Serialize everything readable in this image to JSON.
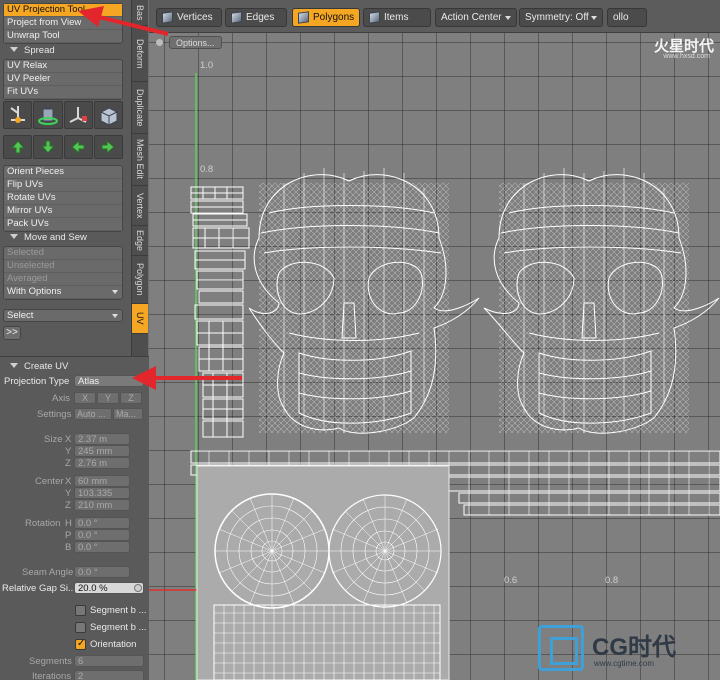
{
  "toolpanel": {
    "projection_items": [
      {
        "label": "UV Projection Tool",
        "selected": true
      },
      {
        "label": "Project from View",
        "selected": false
      },
      {
        "label": "Unwrap Tool",
        "selected": false
      }
    ],
    "spread_header": "Spread",
    "spread_items": [
      "UV Relax",
      "UV Peeler",
      "Fit UVs"
    ],
    "icon_buttons": [
      "uv-transform-icon",
      "uv-rotate-icon",
      "uv-scale-icon",
      "uv-box-icon"
    ],
    "arrow_buttons": [
      "arrow-up-icon",
      "arrow-down-icon",
      "arrow-left-icon",
      "arrow-right-icon"
    ],
    "orient_items": [
      "Orient Pieces",
      "Flip UVs",
      "Rotate UVs",
      "Mirror UVs",
      "Pack UVs"
    ],
    "move_sew_header": "Move and Sew",
    "move_sew_items": [
      {
        "label": "Selected",
        "dim": true
      },
      {
        "label": "Unselected",
        "dim": true
      },
      {
        "label": "Averaged",
        "dim": true
      },
      {
        "label": "With Options",
        "dim": false
      }
    ],
    "select_label": "Select",
    "more_label": ">>"
  },
  "vtabs": [
    "Bas",
    "Deform",
    "Duplicate",
    "Mesh Edit",
    "Vertex",
    "Edge",
    "Polygon",
    "UV"
  ],
  "props": {
    "header": "Create UV",
    "projection_type_label": "Projection Type",
    "projection_type_value": "Atlas",
    "axis_label": "Axis",
    "axis_options": [
      "X",
      "Y",
      "Z"
    ],
    "settings_label": "Settings",
    "settings_options": [
      "Auto ...",
      "Ma..."
    ],
    "size_label": "Size",
    "size": {
      "x": "2.37 m",
      "y": "245 mm",
      "z": "2.76 m"
    },
    "center_label": "Center",
    "center": {
      "x": "60 mm",
      "y": "103.335",
      "z": "210 mm"
    },
    "rotation_label": "Rotation",
    "rotation": {
      "h": "0.0 °",
      "p": "0.0 °",
      "b": "0.0 °"
    },
    "seam_angle_label": "Seam Angle",
    "seam_angle_value": "0.0 °",
    "relative_gap_label": "Relative Gap Si...",
    "relative_gap_value": "20.0 %",
    "checkboxes": [
      {
        "label": "Segment b ...",
        "checked": false
      },
      {
        "label": "Segment b ...",
        "checked": false
      },
      {
        "label": "Orientation",
        "checked": true
      }
    ],
    "segments_label": "Segments",
    "segments_value": "6",
    "iterations_label": "Iterations",
    "iterations_value": "2"
  },
  "toolbar": {
    "vertices": "Vertices",
    "edges": "Edges",
    "polygons": "Polygons",
    "items": "Items",
    "action_center": "Action Center",
    "symmetry": "Symmetry: Off",
    "cut_label": "ollo"
  },
  "viewport": {
    "options_label": "Options...",
    "axis_labels": {
      "y_top": "1.0",
      "y_mid": "0.8",
      "x_a": "0.6",
      "x_b": "0.8"
    },
    "watermark_top": "火星时代",
    "watermark_top_sub": "www.hxsd.com",
    "watermark_brand": "CG时代",
    "watermark_url": "www.cgtime.com"
  },
  "colors": {
    "accent": "#f5a623",
    "wire": "#ffffff",
    "annotation": "#e3262b"
  }
}
